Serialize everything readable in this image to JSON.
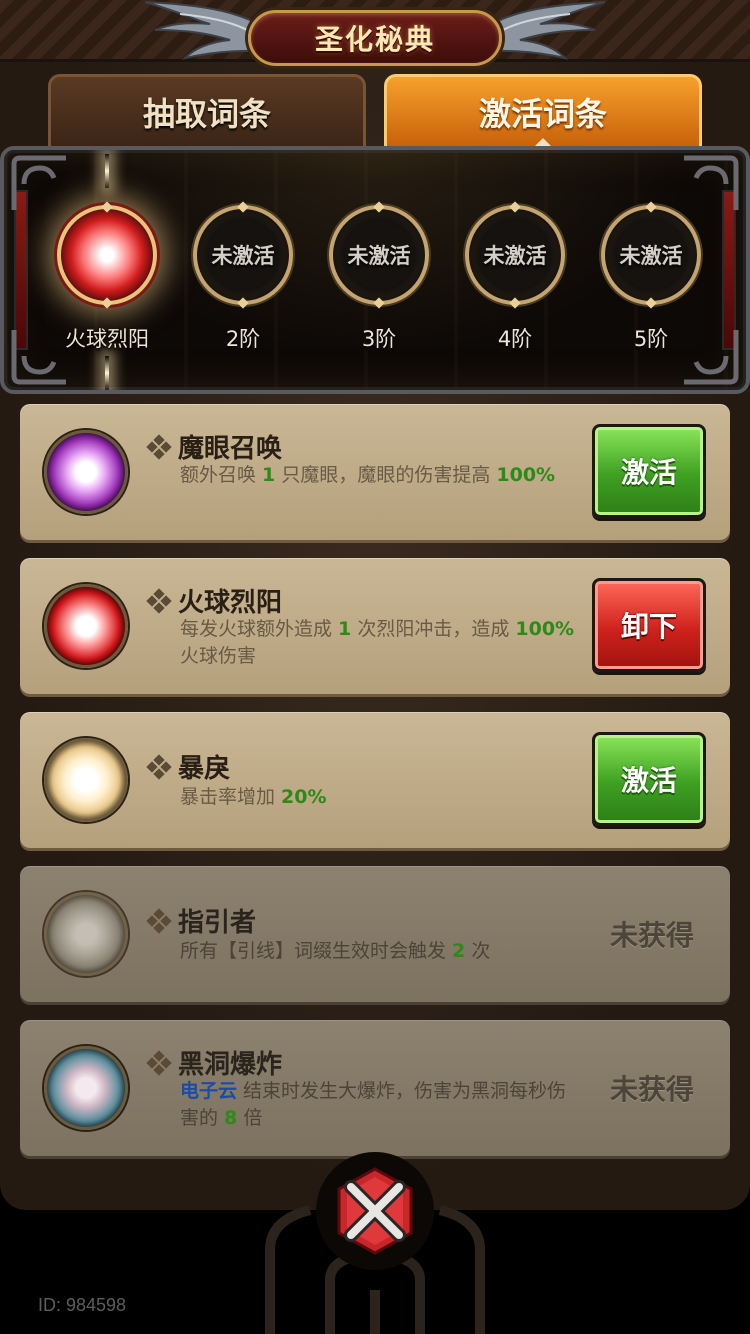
{
  "header": {
    "title": "圣化秘典"
  },
  "tabs": [
    {
      "label": "抽取词条",
      "active": false
    },
    {
      "label": "激活词条",
      "active": true
    }
  ],
  "tiers": [
    {
      "ring_text": "",
      "label": "火球烈阳",
      "active": true
    },
    {
      "ring_text": "未激活",
      "label": "2阶",
      "active": false
    },
    {
      "ring_text": "未激活",
      "label": "3阶",
      "active": false
    },
    {
      "ring_text": "未激活",
      "label": "4阶",
      "active": false
    },
    {
      "ring_text": "未激活",
      "label": "5阶",
      "active": false
    }
  ],
  "entries": [
    {
      "name": "魔眼召唤",
      "orb": "purple",
      "desc": {
        "a": "额外召唤 ",
        "n1": "1",
        "b": " 只魔眼，魔眼的伤害提高 ",
        "n2": "100%"
      },
      "action": {
        "type": "button",
        "style": "green",
        "label": "激活"
      }
    },
    {
      "name": "火球烈阳",
      "orb": "red",
      "desc": {
        "a": "每发火球额外造成 ",
        "n1": "1",
        "b": " 次烈阳冲击，造成 ",
        "n2": "100%",
        "c": " 火球伤害"
      },
      "action": {
        "type": "button",
        "style": "red",
        "label": "卸下"
      }
    },
    {
      "name": "暴戾",
      "orb": "gold",
      "desc": {
        "a": "暴击率增加 ",
        "n1": "20%"
      },
      "action": {
        "type": "button",
        "style": "green",
        "label": "激活"
      }
    },
    {
      "name": "指引者",
      "orb": "grey",
      "desc": {
        "a": "所有【引线】词缀生效时会触发 ",
        "n1": "2",
        "b": " 次"
      },
      "action": {
        "type": "status",
        "label": "未获得"
      }
    },
    {
      "name": "黑洞爆炸",
      "orb": "teal",
      "desc": {
        "link": "电子云",
        "a": " 结束时发生大爆炸，伤害为黑洞每秒伤害的 ",
        "n1": "8",
        "b": " 倍"
      },
      "action": {
        "type": "status",
        "label": "未获得"
      }
    }
  ],
  "footer": {
    "id_text": "ID: 984598"
  },
  "colors": {
    "accent_orange": "#f7a02c",
    "button_green": "#3ea021",
    "button_red": "#d0221c",
    "highlight_number": "#2e8a18",
    "link_blue": "#1c4aa8"
  },
  "icons": [
    "wing-ornament-icon",
    "close-x-icon",
    "diamond-bullet-icon",
    "orb-icon"
  ]
}
